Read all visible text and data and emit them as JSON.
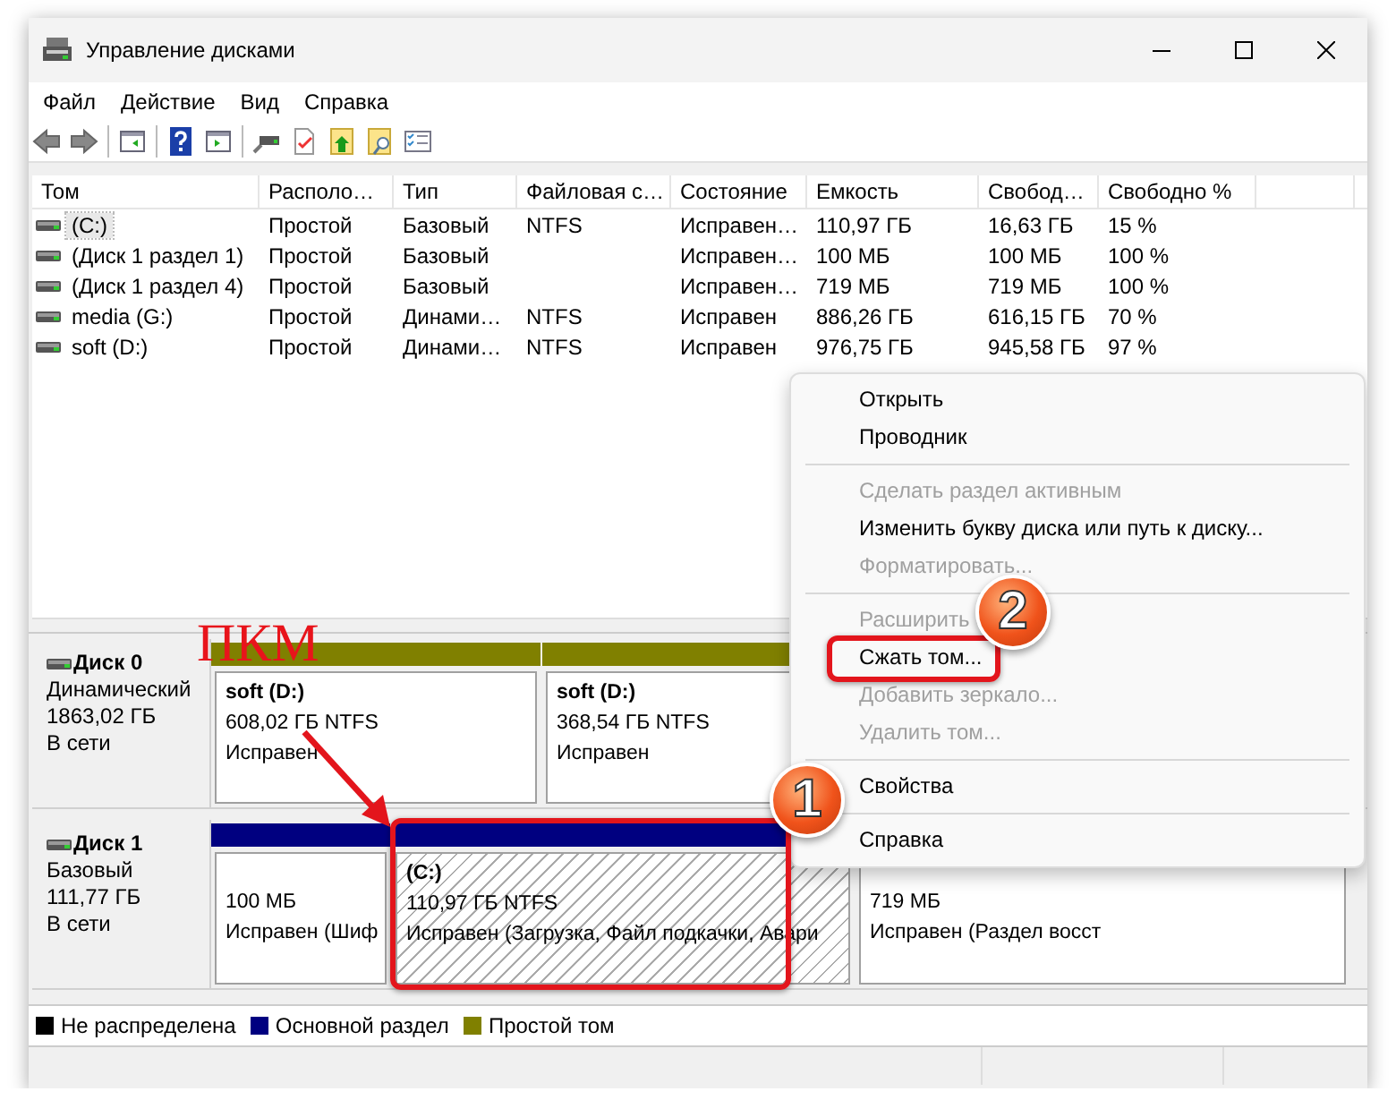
{
  "window": {
    "title": "Управление дисками"
  },
  "menu_bar": [
    "Файл",
    "Действие",
    "Вид",
    "Справка"
  ],
  "volume_table": {
    "columns": [
      "Том",
      "Располо…",
      "Тип",
      "Файловая с…",
      "Состояние",
      "Емкость",
      "Свобод…",
      "Свободно %"
    ],
    "rows": [
      {
        "selected": true,
        "cells": [
          "(C:)",
          "Простой",
          "Базовый",
          "NTFS",
          "Исправен…",
          "110,97 ГБ",
          "16,63 ГБ",
          "15 %"
        ]
      },
      {
        "selected": false,
        "cells": [
          "(Диск 1 раздел 1)",
          "Простой",
          "Базовый",
          "",
          "Исправен…",
          "100 МБ",
          "100 МБ",
          "100 %"
        ]
      },
      {
        "selected": false,
        "cells": [
          "(Диск 1 раздел 4)",
          "Простой",
          "Базовый",
          "",
          "Исправен…",
          "719 МБ",
          "719 МБ",
          "100 %"
        ]
      },
      {
        "selected": false,
        "cells": [
          "media (G:)",
          "Простой",
          "Динами…",
          "NTFS",
          "Исправен",
          "886,26 ГБ",
          "616,15 ГБ",
          "70 %"
        ]
      },
      {
        "selected": false,
        "cells": [
          "soft (D:)",
          "Простой",
          "Динами…",
          "NTFS",
          "Исправен",
          "976,75 ГБ",
          "945,58 ГБ",
          "97 %"
        ]
      }
    ]
  },
  "disks": [
    {
      "name": "Диск 0",
      "type": "Динамический",
      "size": "1863,02 ГБ",
      "status": "В сети",
      "partitions": [
        {
          "name": "soft  (D:)",
          "size": "608,02 ГБ NTFS",
          "status": "Исправен",
          "color": "#808000",
          "hatched": false
        },
        {
          "name": "soft  (D:)",
          "size": "368,54 ГБ NTFS",
          "status": "Исправен",
          "color": "#808000",
          "hatched": false
        }
      ]
    },
    {
      "name": "Диск 1",
      "type": "Базовый",
      "size": "111,77 ГБ",
      "status": "В сети",
      "partitions": [
        {
          "size": "100 МБ",
          "status": "Исправен (Шиф",
          "color": "#000080",
          "hatched": false
        },
        {
          "name": "(C:)",
          "size": "110,97 ГБ NTFS",
          "status": "Исправен (Загрузка, Файл подкачки, Авари",
          "color": "#000080",
          "hatched": true
        },
        {
          "size": "719 МБ",
          "status": "Исправен (Раздел восст",
          "hatched": false
        }
      ]
    }
  ],
  "legend": [
    {
      "label": "Не распределена",
      "color": "#000000"
    },
    {
      "label": "Основной раздел",
      "color": "#000080"
    },
    {
      "label": "Простой том",
      "color": "#808000"
    }
  ],
  "context_menu": [
    {
      "kind": "item",
      "label": "Открыть",
      "disabled": false
    },
    {
      "kind": "item",
      "label": "Проводник",
      "disabled": false
    },
    {
      "kind": "separator"
    },
    {
      "kind": "item",
      "label": "Сделать раздел активным",
      "disabled": true
    },
    {
      "kind": "item",
      "label": "Изменить букву диска или путь к диску...",
      "disabled": false
    },
    {
      "kind": "item",
      "label": "Форматировать...",
      "disabled": true
    },
    {
      "kind": "separator"
    },
    {
      "kind": "item",
      "label": "Расширить",
      "disabled": true
    },
    {
      "kind": "item",
      "label": "Сжать том...",
      "disabled": false
    },
    {
      "kind": "item",
      "label": "Добавить зеркало...",
      "disabled": true
    },
    {
      "kind": "item",
      "label": "Удалить том...",
      "disabled": true
    },
    {
      "kind": "separator"
    },
    {
      "kind": "item",
      "label": "Свойства",
      "disabled": false
    },
    {
      "kind": "separator"
    },
    {
      "kind": "item",
      "label": "Справка",
      "disabled": false
    }
  ],
  "annotations": [
    {
      "kind": "label",
      "text": "ПКМ"
    },
    {
      "kind": "arrow"
    },
    {
      "kind": "highlight"
    },
    {
      "kind": "highlight"
    },
    {
      "kind": "badge",
      "text": "1"
    },
    {
      "kind": "badge",
      "text": "2"
    }
  ]
}
